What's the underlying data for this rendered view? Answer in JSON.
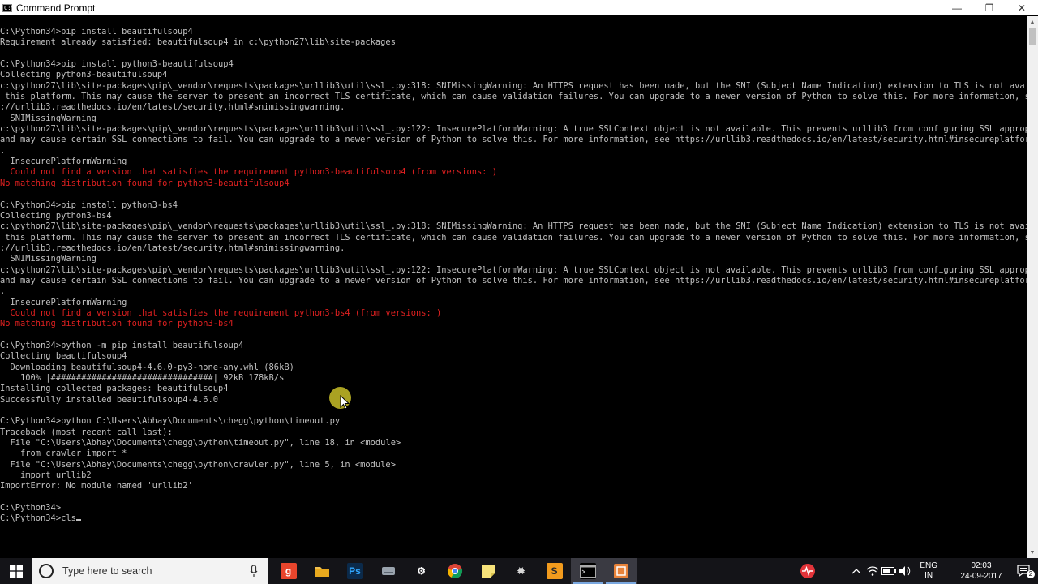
{
  "window": {
    "title": "Command Prompt",
    "controls": [
      "—",
      "❐",
      "✕"
    ]
  },
  "terminal": {
    "lines": [
      {
        "text": "C:\\Python34>pip install beautifulsoup4",
        "type": "normal"
      },
      {
        "text": "Requirement already satisfied: beautifulsoup4 in c:\\python27\\lib\\site-packages",
        "type": "normal"
      },
      {
        "text": "",
        "type": "normal"
      },
      {
        "text": "C:\\Python34>pip install python3-beautifulsoup4",
        "type": "normal"
      },
      {
        "text": "Collecting python3-beautifulsoup4",
        "type": "normal"
      },
      {
        "text": "c:\\python27\\lib\\site-packages\\pip\\_vendor\\requests\\packages\\urllib3\\util\\ssl_.py:318: SNIMissingWarning: An HTTPS request has been made, but the SNI (Subject Name Indication) extension to TLS is not available on",
        "type": "normal"
      },
      {
        "text": " this platform. This may cause the server to present an incorrect TLS certificate, which can cause validation failures. You can upgrade to a newer version of Python to solve this. For more information, see https",
        "type": "normal"
      },
      {
        "text": "://urllib3.readthedocs.io/en/latest/security.html#snimissingwarning.",
        "type": "normal"
      },
      {
        "text": "  SNIMissingWarning",
        "type": "normal"
      },
      {
        "text": "c:\\python27\\lib\\site-packages\\pip\\_vendor\\requests\\packages\\urllib3\\util\\ssl_.py:122: InsecurePlatformWarning: A true SSLContext object is not available. This prevents urllib3 from configuring SSL appropriately",
        "type": "normal"
      },
      {
        "text": "and may cause certain SSL connections to fail. You can upgrade to a newer version of Python to solve this. For more information, see https://urllib3.readthedocs.io/en/latest/security.html#insecureplatformwarning",
        "type": "normal"
      },
      {
        "text": ".",
        "type": "normal"
      },
      {
        "text": "  InsecurePlatformWarning",
        "type": "normal"
      },
      {
        "text": "  Could not find a version that satisfies the requirement python3-beautifulsoup4 (from versions: )",
        "type": "err"
      },
      {
        "text": "No matching distribution found for python3-beautifulsoup4",
        "type": "err"
      },
      {
        "text": "",
        "type": "normal"
      },
      {
        "text": "C:\\Python34>pip install python3-bs4",
        "type": "normal"
      },
      {
        "text": "Collecting python3-bs4",
        "type": "normal"
      },
      {
        "text": "c:\\python27\\lib\\site-packages\\pip\\_vendor\\requests\\packages\\urllib3\\util\\ssl_.py:318: SNIMissingWarning: An HTTPS request has been made, but the SNI (Subject Name Indication) extension to TLS is not available on",
        "type": "normal"
      },
      {
        "text": " this platform. This may cause the server to present an incorrect TLS certificate, which can cause validation failures. You can upgrade to a newer version of Python to solve this. For more information, see https",
        "type": "normal"
      },
      {
        "text": "://urllib3.readthedocs.io/en/latest/security.html#snimissingwarning.",
        "type": "normal"
      },
      {
        "text": "  SNIMissingWarning",
        "type": "normal"
      },
      {
        "text": "c:\\python27\\lib\\site-packages\\pip\\_vendor\\requests\\packages\\urllib3\\util\\ssl_.py:122: InsecurePlatformWarning: A true SSLContext object is not available. This prevents urllib3 from configuring SSL appropriately",
        "type": "normal"
      },
      {
        "text": "and may cause certain SSL connections to fail. You can upgrade to a newer version of Python to solve this. For more information, see https://urllib3.readthedocs.io/en/latest/security.html#insecureplatformwarning",
        "type": "normal"
      },
      {
        "text": ".",
        "type": "normal"
      },
      {
        "text": "  InsecurePlatformWarning",
        "type": "normal"
      },
      {
        "text": "  Could not find a version that satisfies the requirement python3-bs4 (from versions: )",
        "type": "err"
      },
      {
        "text": "No matching distribution found for python3-bs4",
        "type": "err"
      },
      {
        "text": "",
        "type": "normal"
      },
      {
        "text": "C:\\Python34>python -m pip install beautifulsoup4",
        "type": "normal"
      },
      {
        "text": "Collecting beautifulsoup4",
        "type": "normal"
      },
      {
        "text": "  Downloading beautifulsoup4-4.6.0-py3-none-any.whl (86kB)",
        "type": "normal"
      },
      {
        "text": "    100% |################################| 92kB 178kB/s",
        "type": "normal"
      },
      {
        "text": "Installing collected packages: beautifulsoup4",
        "type": "normal"
      },
      {
        "text": "Successfully installed beautifulsoup4-4.6.0",
        "type": "normal"
      },
      {
        "text": "",
        "type": "normal"
      },
      {
        "text": "C:\\Python34>python C:\\Users\\Abhay\\Documents\\chegg\\python\\timeout.py",
        "type": "normal"
      },
      {
        "text": "Traceback (most recent call last):",
        "type": "normal"
      },
      {
        "text": "  File \"C:\\Users\\Abhay\\Documents\\chegg\\python\\timeout.py\", line 18, in <module>",
        "type": "normal"
      },
      {
        "text": "    from crawler import *",
        "type": "normal"
      },
      {
        "text": "  File \"C:\\Users\\Abhay\\Documents\\chegg\\python\\crawler.py\", line 5, in <module>",
        "type": "normal"
      },
      {
        "text": "    import urllib2",
        "type": "normal"
      },
      {
        "text": "ImportError: No module named 'urllib2'",
        "type": "normal"
      },
      {
        "text": "",
        "type": "normal"
      },
      {
        "text": "C:\\Python34>",
        "type": "normal"
      },
      {
        "text": "C:\\Python34>cls",
        "type": "normal",
        "cursor": true
      }
    ]
  },
  "taskbar": {
    "search_placeholder": "Type here to search",
    "apps": [
      {
        "icon": "g-app-icon",
        "glyph": "g",
        "bg": "#e8452c",
        "fg": "#ffffff",
        "active": false
      },
      {
        "icon": "file-explorer-icon",
        "glyph": "",
        "bg": "#f2c14e",
        "fg": "#7a5a10",
        "active": false
      },
      {
        "icon": "photoshop-icon",
        "glyph": "Ps",
        "bg": "#0b2a4a",
        "fg": "#31a8ff",
        "active": false
      },
      {
        "icon": "hard-drive-icon",
        "glyph": "",
        "bg": "#9aa4ae",
        "fg": "#ffffff",
        "active": false
      },
      {
        "icon": "settings-gear-icon",
        "glyph": "⚙",
        "bg": "transparent",
        "fg": "#ffffff",
        "active": false
      },
      {
        "icon": "chrome-icon",
        "glyph": "",
        "bg": "transparent",
        "fg": "#ffffff",
        "active": false
      },
      {
        "icon": "sticky-notes-icon",
        "glyph": "",
        "bg": "#f6e27a",
        "fg": "#6a5a00",
        "active": false
      },
      {
        "icon": "system-settings-icon",
        "glyph": "✹",
        "bg": "transparent",
        "fg": "#d8d8d8",
        "active": false
      },
      {
        "icon": "sublime-text-icon",
        "glyph": "S",
        "bg": "#f29b1d",
        "fg": "#2b2b2b",
        "active": false
      },
      {
        "icon": "command-prompt-icon",
        "glyph": "",
        "bg": "#000000",
        "fg": "#c0c0c0",
        "active": true
      },
      {
        "icon": "screen-recorder-icon",
        "glyph": "",
        "bg": "#e8833a",
        "fg": "#ffffff",
        "active": true
      }
    ],
    "tray": {
      "language_top": "ENG",
      "language_bottom": "IN",
      "time": "02:03",
      "date": "24-09-2017",
      "notification_count": "2"
    }
  }
}
